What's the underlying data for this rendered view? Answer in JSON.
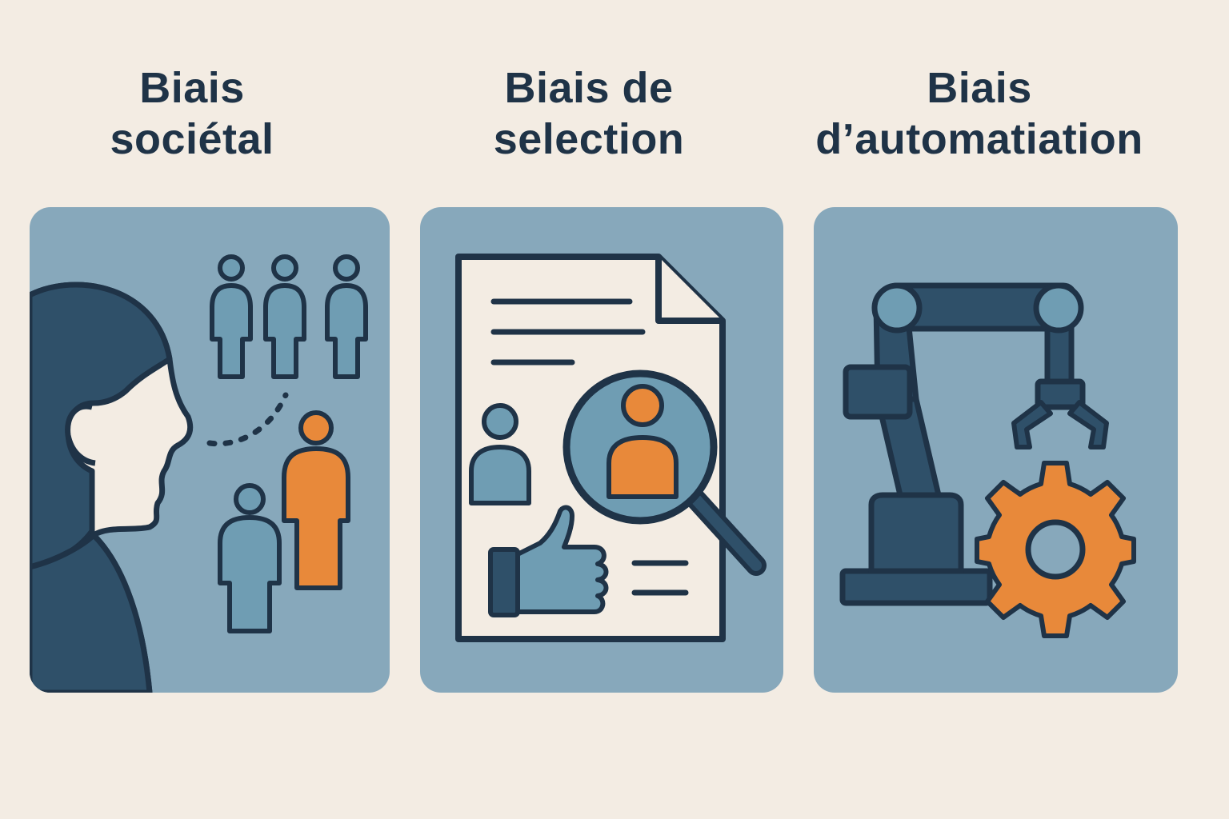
{
  "panels": [
    {
      "title_line1": "Biais",
      "title_line2": "sociétal",
      "icon": "society-people-icon"
    },
    {
      "title_line1": "Biais de",
      "title_line2": "selection",
      "icon": "resume-search-icon"
    },
    {
      "title_line1": "Biais",
      "title_line2": "d’automatiation",
      "icon": "robot-arm-gear-icon"
    }
  ],
  "colors": {
    "background": "#f3ece3",
    "panel": "#87a8bb",
    "navy": "#1f3347",
    "dark_blue": "#2f5069",
    "mid_blue": "#6f9db3",
    "orange": "#e8893a",
    "cream": "#f3ece3"
  }
}
